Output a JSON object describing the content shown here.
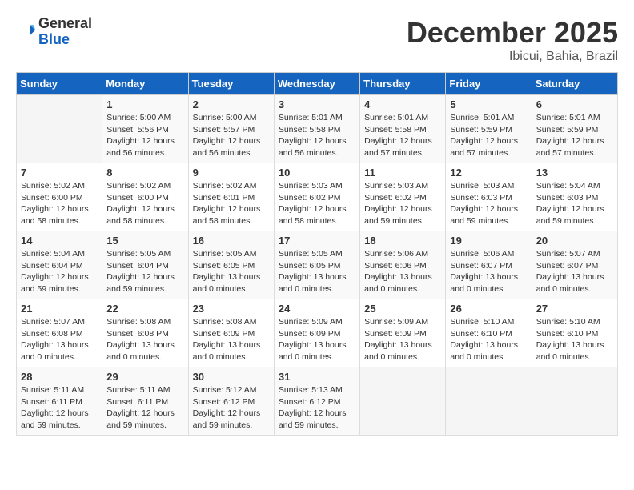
{
  "logo": {
    "general": "General",
    "blue": "Blue"
  },
  "title": "December 2025",
  "location": "Ibicui, Bahia, Brazil",
  "headers": [
    "Sunday",
    "Monday",
    "Tuesday",
    "Wednesday",
    "Thursday",
    "Friday",
    "Saturday"
  ],
  "weeks": [
    [
      {
        "day": "",
        "sunrise": "",
        "sunset": "",
        "daylight": ""
      },
      {
        "day": "1",
        "sunrise": "Sunrise: 5:00 AM",
        "sunset": "Sunset: 5:56 PM",
        "daylight": "Daylight: 12 hours and 56 minutes."
      },
      {
        "day": "2",
        "sunrise": "Sunrise: 5:00 AM",
        "sunset": "Sunset: 5:57 PM",
        "daylight": "Daylight: 12 hours and 56 minutes."
      },
      {
        "day": "3",
        "sunrise": "Sunrise: 5:01 AM",
        "sunset": "Sunset: 5:58 PM",
        "daylight": "Daylight: 12 hours and 56 minutes."
      },
      {
        "day": "4",
        "sunrise": "Sunrise: 5:01 AM",
        "sunset": "Sunset: 5:58 PM",
        "daylight": "Daylight: 12 hours and 57 minutes."
      },
      {
        "day": "5",
        "sunrise": "Sunrise: 5:01 AM",
        "sunset": "Sunset: 5:59 PM",
        "daylight": "Daylight: 12 hours and 57 minutes."
      },
      {
        "day": "6",
        "sunrise": "Sunrise: 5:01 AM",
        "sunset": "Sunset: 5:59 PM",
        "daylight": "Daylight: 12 hours and 57 minutes."
      }
    ],
    [
      {
        "day": "7",
        "sunrise": "Sunrise: 5:02 AM",
        "sunset": "Sunset: 6:00 PM",
        "daylight": "Daylight: 12 hours and 58 minutes."
      },
      {
        "day": "8",
        "sunrise": "Sunrise: 5:02 AM",
        "sunset": "Sunset: 6:00 PM",
        "daylight": "Daylight: 12 hours and 58 minutes."
      },
      {
        "day": "9",
        "sunrise": "Sunrise: 5:02 AM",
        "sunset": "Sunset: 6:01 PM",
        "daylight": "Daylight: 12 hours and 58 minutes."
      },
      {
        "day": "10",
        "sunrise": "Sunrise: 5:03 AM",
        "sunset": "Sunset: 6:02 PM",
        "daylight": "Daylight: 12 hours and 58 minutes."
      },
      {
        "day": "11",
        "sunrise": "Sunrise: 5:03 AM",
        "sunset": "Sunset: 6:02 PM",
        "daylight": "Daylight: 12 hours and 59 minutes."
      },
      {
        "day": "12",
        "sunrise": "Sunrise: 5:03 AM",
        "sunset": "Sunset: 6:03 PM",
        "daylight": "Daylight: 12 hours and 59 minutes."
      },
      {
        "day": "13",
        "sunrise": "Sunrise: 5:04 AM",
        "sunset": "Sunset: 6:03 PM",
        "daylight": "Daylight: 12 hours and 59 minutes."
      }
    ],
    [
      {
        "day": "14",
        "sunrise": "Sunrise: 5:04 AM",
        "sunset": "Sunset: 6:04 PM",
        "daylight": "Daylight: 12 hours and 59 minutes."
      },
      {
        "day": "15",
        "sunrise": "Sunrise: 5:05 AM",
        "sunset": "Sunset: 6:04 PM",
        "daylight": "Daylight: 12 hours and 59 minutes."
      },
      {
        "day": "16",
        "sunrise": "Sunrise: 5:05 AM",
        "sunset": "Sunset: 6:05 PM",
        "daylight": "Daylight: 13 hours and 0 minutes."
      },
      {
        "day": "17",
        "sunrise": "Sunrise: 5:05 AM",
        "sunset": "Sunset: 6:05 PM",
        "daylight": "Daylight: 13 hours and 0 minutes."
      },
      {
        "day": "18",
        "sunrise": "Sunrise: 5:06 AM",
        "sunset": "Sunset: 6:06 PM",
        "daylight": "Daylight: 13 hours and 0 minutes."
      },
      {
        "day": "19",
        "sunrise": "Sunrise: 5:06 AM",
        "sunset": "Sunset: 6:07 PM",
        "daylight": "Daylight: 13 hours and 0 minutes."
      },
      {
        "day": "20",
        "sunrise": "Sunrise: 5:07 AM",
        "sunset": "Sunset: 6:07 PM",
        "daylight": "Daylight: 13 hours and 0 minutes."
      }
    ],
    [
      {
        "day": "21",
        "sunrise": "Sunrise: 5:07 AM",
        "sunset": "Sunset: 6:08 PM",
        "daylight": "Daylight: 13 hours and 0 minutes."
      },
      {
        "day": "22",
        "sunrise": "Sunrise: 5:08 AM",
        "sunset": "Sunset: 6:08 PM",
        "daylight": "Daylight: 13 hours and 0 minutes."
      },
      {
        "day": "23",
        "sunrise": "Sunrise: 5:08 AM",
        "sunset": "Sunset: 6:09 PM",
        "daylight": "Daylight: 13 hours and 0 minutes."
      },
      {
        "day": "24",
        "sunrise": "Sunrise: 5:09 AM",
        "sunset": "Sunset: 6:09 PM",
        "daylight": "Daylight: 13 hours and 0 minutes."
      },
      {
        "day": "25",
        "sunrise": "Sunrise: 5:09 AM",
        "sunset": "Sunset: 6:09 PM",
        "daylight": "Daylight: 13 hours and 0 minutes."
      },
      {
        "day": "26",
        "sunrise": "Sunrise: 5:10 AM",
        "sunset": "Sunset: 6:10 PM",
        "daylight": "Daylight: 13 hours and 0 minutes."
      },
      {
        "day": "27",
        "sunrise": "Sunrise: 5:10 AM",
        "sunset": "Sunset: 6:10 PM",
        "daylight": "Daylight: 13 hours and 0 minutes."
      }
    ],
    [
      {
        "day": "28",
        "sunrise": "Sunrise: 5:11 AM",
        "sunset": "Sunset: 6:11 PM",
        "daylight": "Daylight: 12 hours and 59 minutes."
      },
      {
        "day": "29",
        "sunrise": "Sunrise: 5:11 AM",
        "sunset": "Sunset: 6:11 PM",
        "daylight": "Daylight: 12 hours and 59 minutes."
      },
      {
        "day": "30",
        "sunrise": "Sunrise: 5:12 AM",
        "sunset": "Sunset: 6:12 PM",
        "daylight": "Daylight: 12 hours and 59 minutes."
      },
      {
        "day": "31",
        "sunrise": "Sunrise: 5:13 AM",
        "sunset": "Sunset: 6:12 PM",
        "daylight": "Daylight: 12 hours and 59 minutes."
      },
      {
        "day": "",
        "sunrise": "",
        "sunset": "",
        "daylight": ""
      },
      {
        "day": "",
        "sunrise": "",
        "sunset": "",
        "daylight": ""
      },
      {
        "day": "",
        "sunrise": "",
        "sunset": "",
        "daylight": ""
      }
    ]
  ]
}
